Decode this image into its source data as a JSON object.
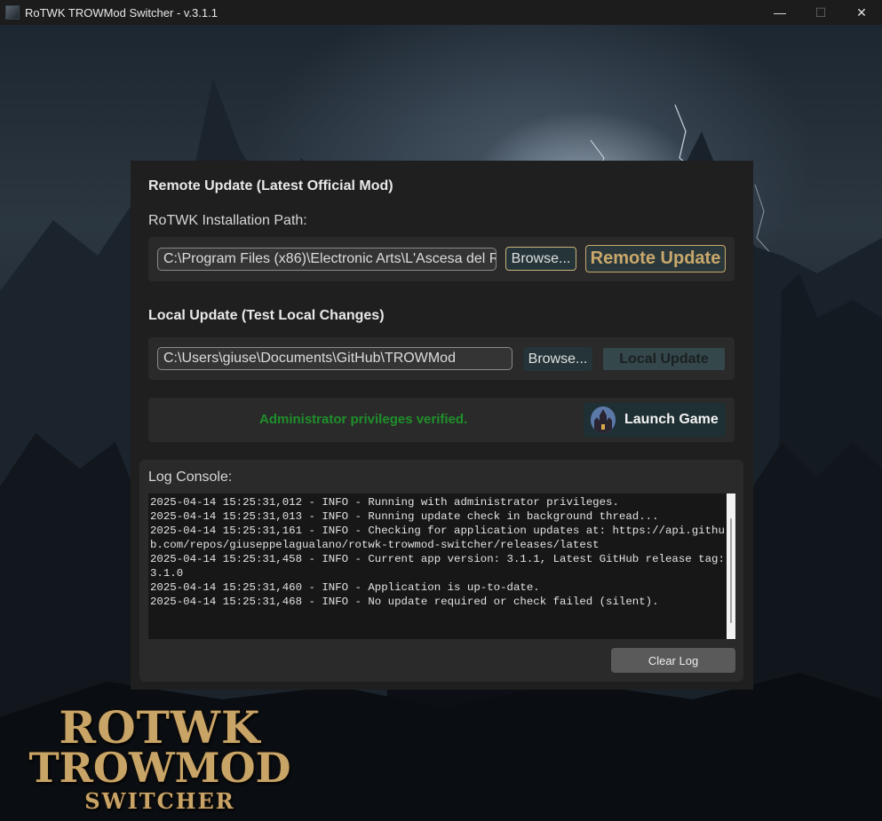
{
  "window": {
    "title": "RoTWK TROWMod Switcher - v.3.1.1",
    "minimize_glyph": "—",
    "maximize_glyph": "☐",
    "close_glyph": "✕"
  },
  "remote": {
    "section_title": "Remote Update (Latest Official Mod)",
    "path_label": "RoTWK Installation Path:",
    "path_value": "C:\\Program Files (x86)\\Electronic Arts\\L'Ascesa del R",
    "browse_label": "Browse...",
    "update_label": "Remote Update"
  },
  "local": {
    "section_title": "Local Update (Test Local Changes)",
    "path_value": "C:\\Users\\giuse\\Documents\\GitHub\\TROWMod",
    "browse_label": "Browse...",
    "update_label": "Local Update"
  },
  "status": {
    "message": "Administrator privileges verified.",
    "color": "#1f8f2a",
    "launch_label": "Launch Game"
  },
  "log": {
    "label": "Log Console:",
    "lines": [
      "2025-04-14 15:25:31,012 - INFO - Running with administrator privileges.",
      "2025-04-14 15:25:31,013 - INFO - Running update check in background thread...",
      "2025-04-14 15:25:31,161 - INFO - Checking for application updates at: https://api.github.com/repos/giuseppelagualano/rotwk-trowmod-switcher/releases/latest",
      "2025-04-14 15:25:31,458 - INFO - Current app version: 3.1.1, Latest GitHub release tag: 3.1.0",
      "2025-04-14 15:25:31,460 - INFO - Application is up-to-date.",
      "2025-04-14 15:25:31,468 - INFO - No update required or check failed (silent)."
    ],
    "clear_label": "Clear Log"
  },
  "logo": {
    "line1": "ROTWK",
    "line2": "TROWMOD",
    "line3": "SWITCHER"
  },
  "colors": {
    "accent_gold": "#c9a86b",
    "panel_bg": "#1f1f1f"
  }
}
